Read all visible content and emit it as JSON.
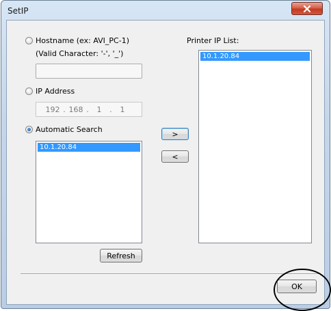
{
  "window": {
    "title": "SetIP",
    "close_icon": "close-icon"
  },
  "hostname": {
    "label": "Hostname (ex: AVI_PC-1)",
    "hint": "(Valid Character: '-', '_')",
    "value": "",
    "selected": false
  },
  "ip_address": {
    "label": "IP Address",
    "octets": [
      "192",
      "168",
      "1",
      "1"
    ],
    "dot": ".",
    "selected": false
  },
  "automatic_search": {
    "label": "Automatic Search",
    "selected": true,
    "results": [
      "10.1.20.84"
    ],
    "refresh_label": "Refresh"
  },
  "transfer": {
    "add_label": ">",
    "remove_label": "<"
  },
  "printer_list": {
    "label": "Printer IP List:",
    "items": [
      "10.1.20.84"
    ]
  },
  "footer": {
    "ok_label": "OK"
  },
  "colors": {
    "selection": "#3399ff",
    "annotation_circle": "#000000"
  }
}
